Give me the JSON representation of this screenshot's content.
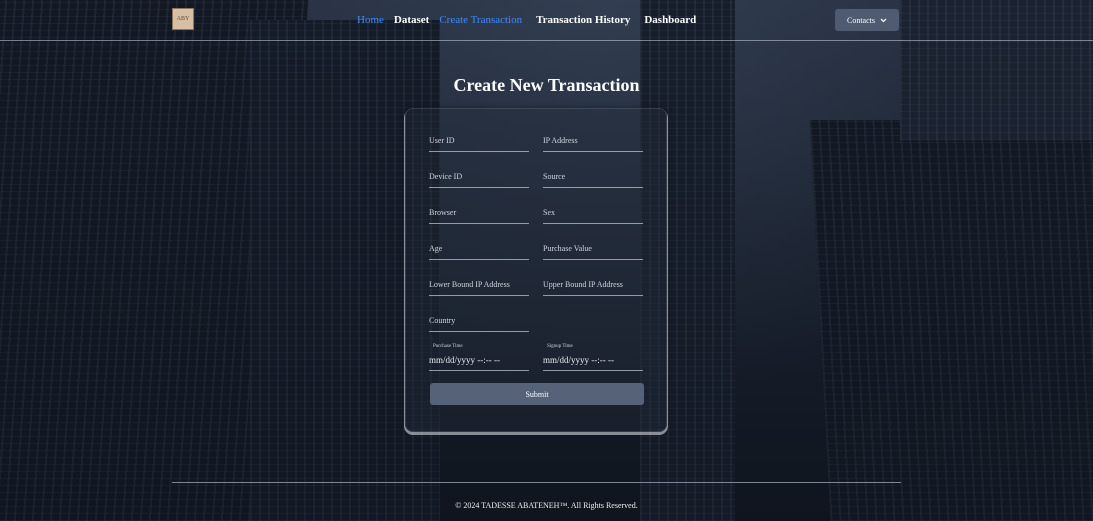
{
  "nav": {
    "logo_text": "ABY",
    "items": [
      {
        "label": "Home",
        "active": true
      },
      {
        "label": "Dataset"
      },
      {
        "label": "Create Transaction",
        "active": true
      },
      {
        "label": "Transaction History"
      },
      {
        "label": "Dashboard"
      }
    ],
    "contacts_label": "Contacts",
    "contacts_icon": "chevron-down-icon"
  },
  "page": {
    "title": "Create New Transaction"
  },
  "form": {
    "fields": [
      {
        "placeholder": "User ID"
      },
      {
        "placeholder": "IP Address"
      },
      {
        "placeholder": "Device ID"
      },
      {
        "placeholder": "Source"
      },
      {
        "placeholder": "Browser"
      },
      {
        "placeholder": "Sex"
      },
      {
        "placeholder": "Age"
      },
      {
        "placeholder": "Purchase Value"
      },
      {
        "placeholder": "Lower Bound IP Address"
      },
      {
        "placeholder": "Upper Bound IP Address"
      },
      {
        "placeholder": "Country"
      }
    ],
    "purchase_time": {
      "label": "Purchase Time",
      "value": "mm/dd/yyyy --:-- --"
    },
    "signup_time": {
      "label": "Signup Time",
      "value": "mm/dd/yyyy --:-- --"
    },
    "submit_label": "Submit"
  },
  "footer": {
    "text": "© 2024 TADESSE ABATENEH™. All Rights Reserved."
  },
  "colors": {
    "accent": "#3f8cff",
    "button": "#556277",
    "contacts_button": "#4e5b70"
  }
}
